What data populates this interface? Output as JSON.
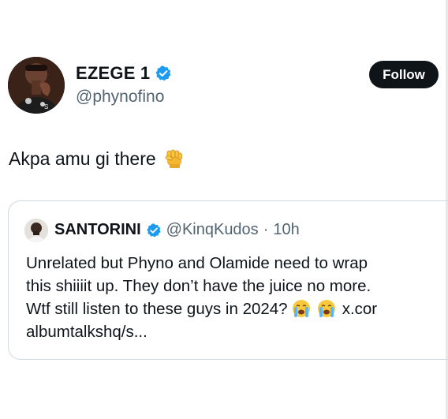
{
  "author": {
    "display_name": "EZEGE 1",
    "handle": "@phynofino",
    "verified_icon": "verified-badge-icon",
    "avatar_icon": "avatar"
  },
  "follow_button": {
    "label": "Follow"
  },
  "tweet": {
    "text": "Akpa amu gi there",
    "emoji_icon": "raised-fist-icon"
  },
  "quoted_tweet": {
    "display_name": "SANTORINI",
    "handle": "@KinqKudos",
    "separator": "·",
    "time": "10h",
    "lines": [
      "Unrelated but Phyno and Olamide need to wrap",
      "this shiiiit up. They don’t have the juice no more.",
      "Wtf still listen to these guys in 2024?",
      "albumtalkshq/s..."
    ],
    "link_fragment": "x.cor",
    "emoji_icon": "loudly-crying-face-icon"
  },
  "colors": {
    "text": "#0f1419",
    "secondary_text": "#536471",
    "verified_blue": "#1d9bf0",
    "button_bg": "#0f1419",
    "border": "#cfd9de"
  }
}
